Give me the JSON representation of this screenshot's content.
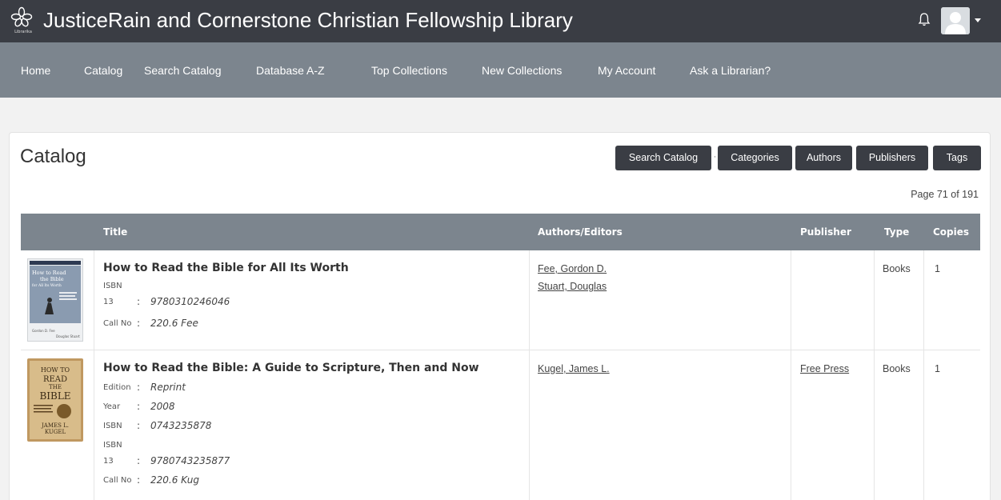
{
  "app": {
    "logo_text": "Librarika",
    "title": "JusticeRain and Cornerstone Christian Fellowship Library"
  },
  "nav": {
    "items": [
      "Home",
      "Catalog",
      "Search Catalog",
      "Database A-Z",
      "Top Collections",
      "New Collections",
      "My Account",
      "Ask a Librarian?"
    ]
  },
  "page": {
    "heading": "Catalog",
    "buttons": {
      "search": "Search Catalog",
      "categories": "Categories",
      "authors": "Authors",
      "publishers": "Publishers",
      "tags": "Tags"
    },
    "separator": "·",
    "page_info": "Page 71 of 191"
  },
  "table": {
    "headers": {
      "title": "Title",
      "authors": "Authors/Editors",
      "publisher": "Publisher",
      "type": "Type",
      "copies": "Copies"
    },
    "rows": [
      {
        "title": "How to Read the Bible for All Its Worth",
        "cover": {
          "line1": "How to Read",
          "line2": "the Bible",
          "line3": "for All Its Worth",
          "footer1": "Gordon D. Fee",
          "footer2": "Douglas Stuart"
        },
        "fields": {
          "isbn13_label1": "ISBN",
          "isbn13_label2": "13",
          "isbn13_value": "9780310246046",
          "callno_label": "Call No",
          "callno_value": "220.6 Fee"
        },
        "authors": [
          "Fee, Gordon D.",
          "Stuart, Douglas"
        ],
        "publisher": "",
        "type": "Books",
        "copies": "1"
      },
      {
        "title": "How to Read the Bible: A Guide to Scripture, Then and Now",
        "cover": {
          "line1": "HOW TO",
          "line2": "READ",
          "line3": "THE",
          "line4": "BIBLE",
          "footer1": "JAMES L.",
          "footer2": "KUGEL"
        },
        "fields": {
          "edition_label": "Edition",
          "edition_value": "Reprint",
          "year_label": "Year",
          "year_value": "2008",
          "isbn_label": "ISBN",
          "isbn_value": "0743235878",
          "isbn13_label1": "ISBN",
          "isbn13_label2": "13",
          "isbn13_value": "9780743235877",
          "callno_label": "Call No",
          "callno_value": "220.6 Kug"
        },
        "authors": [
          "Kugel, James L."
        ],
        "publisher": "Free Press",
        "type": "Books",
        "copies": "1"
      }
    ]
  },
  "colors": {
    "topbar": "#3a3d44",
    "navbar": "#7c858e",
    "button": "#3a3d44",
    "cover2": "#b0854f"
  }
}
